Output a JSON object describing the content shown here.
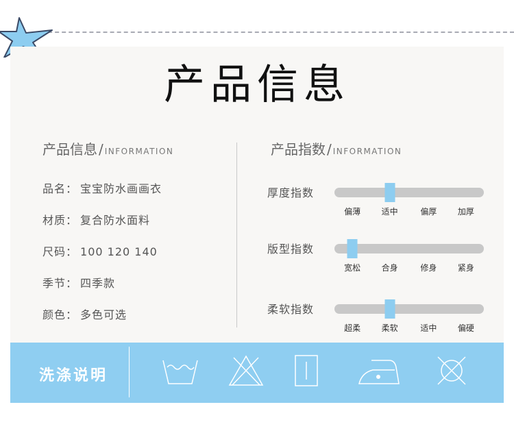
{
  "colors": {
    "accent_blue": "#8dcdf0",
    "panel_bg": "#f8f7f5",
    "track_gray": "#c8c8c8",
    "wash_bg": "#8fcef1"
  },
  "title": "产品信息",
  "left_section": {
    "title_cn": "产品信息",
    "slash": "/",
    "title_en": "INFORMATION",
    "rows": [
      {
        "label": "品名：",
        "value": "宝宝防水画画衣"
      },
      {
        "label": "材质：",
        "value": "复合防水面料"
      },
      {
        "label": "尺码：",
        "value": "100 120 140"
      },
      {
        "label": "季节：",
        "value": "四季款"
      },
      {
        "label": "颜色：",
        "value": "多色可选"
      }
    ]
  },
  "right_section": {
    "title_cn": "产品指数",
    "slash": "/",
    "title_en": "INFORMATION",
    "indices": [
      {
        "label": "厚度指数",
        "ticks": [
          "偏薄",
          "适中",
          "偏厚",
          "加厚"
        ],
        "level": 0.37
      },
      {
        "label": "版型指数",
        "ticks": [
          "宽松",
          "合身",
          "修身",
          "紧身"
        ],
        "level": 0.12
      },
      {
        "label": "柔软指数",
        "ticks": [
          "超柔",
          "柔软",
          "适中",
          "偏硬"
        ],
        "level": 0.37
      }
    ]
  },
  "wash": {
    "title": "洗涤说明",
    "icons": [
      "hand-wash-icon",
      "no-bleach-icon",
      "dry-flat-icon",
      "iron-low-icon",
      "no-tumble-dry-icon"
    ]
  }
}
